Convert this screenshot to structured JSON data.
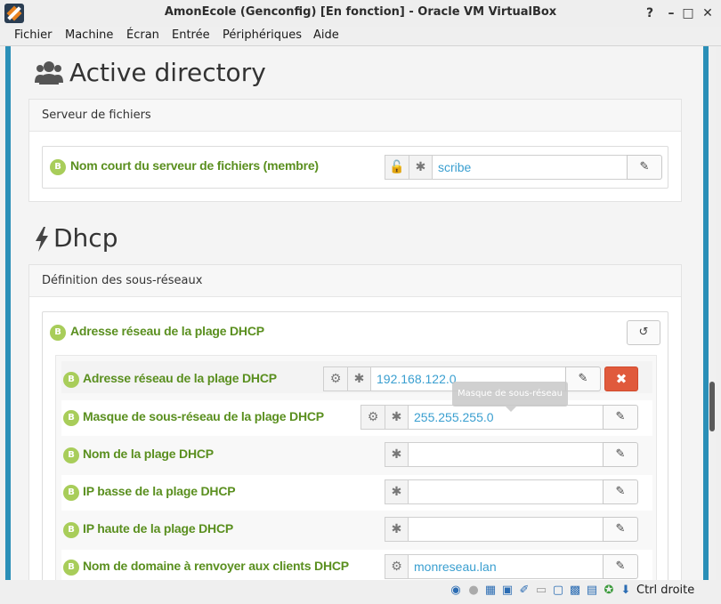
{
  "window": {
    "title": "AmonEcole (Genconfig) [En fonction] - Oracle VM VirtualBox",
    "controls": {
      "help": "?",
      "minimize": "–",
      "maximize": "□",
      "close": "✕"
    }
  },
  "menu": [
    "Fichier",
    "Machine",
    "Écran",
    "Entrée",
    "Périphériques",
    "Aide"
  ],
  "sections": {
    "ad": {
      "title": "Active directory",
      "panel_title": "Serveur de fichiers",
      "field": {
        "badge": "B",
        "label": "Nom court du serveur de fichiers (membre)",
        "value": "scribe"
      }
    },
    "dhcp": {
      "title": "Dhcp",
      "panel_title": "Définition des sous-réseaux",
      "group": {
        "badge": "B",
        "label": "Adresse réseau de la plage DHCP"
      },
      "fields": [
        {
          "badge": "B",
          "label": "Adresse réseau de la plage DHCP",
          "value": "192.168.122.0"
        },
        {
          "badge": "B",
          "label": "Masque de sous-réseau de la plage DHCP",
          "value": "255.255.255.0"
        },
        {
          "badge": "B",
          "label": "Nom de la plage DHCP",
          "value": ""
        },
        {
          "badge": "B",
          "label": "IP basse de la plage DHCP",
          "value": ""
        },
        {
          "badge": "B",
          "label": "IP haute de la plage DHCP",
          "value": ""
        },
        {
          "badge": "B",
          "label": "Nom de domaine à renvoyer aux clients DHCP",
          "value": "monreseau.lan"
        }
      ],
      "tooltip": "Masque de sous-réseau"
    }
  },
  "icons": {
    "users": "users-icon",
    "bolt": "bolt-icon",
    "unlock": "unlock-icon",
    "asterisk": "asterisk-icon",
    "edit": "edit-icon",
    "undo": "undo-icon",
    "cogs": "cogs-icon",
    "close": "close-icon"
  },
  "glyphs": {
    "asterisk": "✱",
    "edit": "✎",
    "undo": "↺",
    "cogs": "⚙",
    "unlock": "🔓",
    "close": "✖"
  },
  "statusbar": {
    "host_key": "Ctrl droite"
  },
  "colors": {
    "accent": "#2a8fb7",
    "label_green": "#5a8f1f",
    "badge_green": "#a8cd5a",
    "value_blue": "#3a9fd0",
    "danger": "#e05a3c"
  }
}
